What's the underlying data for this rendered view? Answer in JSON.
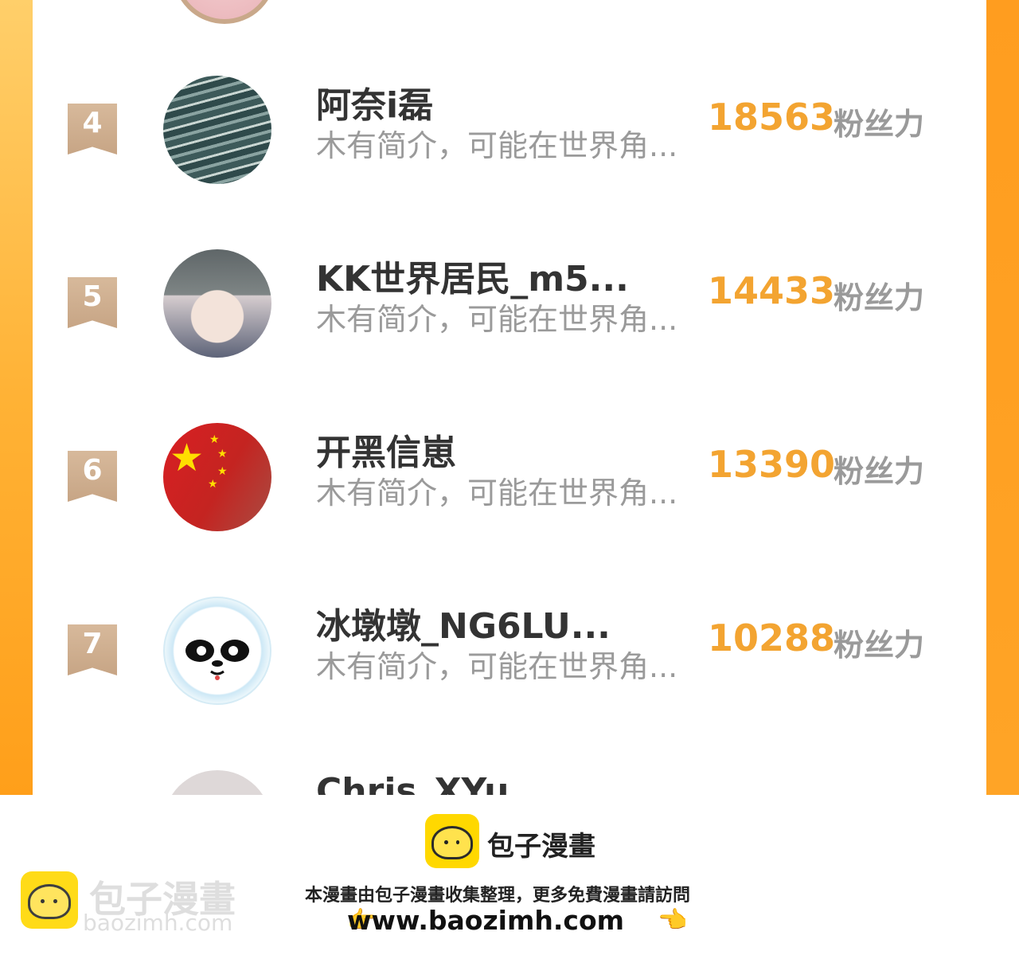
{
  "rows": [
    {
      "rank": "4",
      "name": "阿奈i磊",
      "bio": "木有简介，可能在世界角...",
      "score": "18563",
      "unit": "粉丝力"
    },
    {
      "rank": "5",
      "name": "KK世界居民_m5...",
      "bio": "木有简介，可能在世界角...",
      "score": "14433",
      "unit": "粉丝力"
    },
    {
      "rank": "6",
      "name": "开黑信崽",
      "bio": "木有简介，可能在世界角...",
      "score": "13390",
      "unit": "粉丝力"
    },
    {
      "rank": "7",
      "name": "冰墩墩_NG6LU...",
      "bio": "木有简介，可能在世界角...",
      "score": "10288",
      "unit": "粉丝力"
    },
    {
      "name": "Chris_XYu"
    }
  ],
  "footer": {
    "brand": "包子漫畫",
    "notice": "本漫畫由包子漫畫收集整理，更多免費漫畫請訪問",
    "url": "www.baozimh.com",
    "watermark_name": "包子漫畫",
    "watermark_url": "baozimh.com",
    "hand_left": "👉",
    "hand_right": "👈"
  }
}
